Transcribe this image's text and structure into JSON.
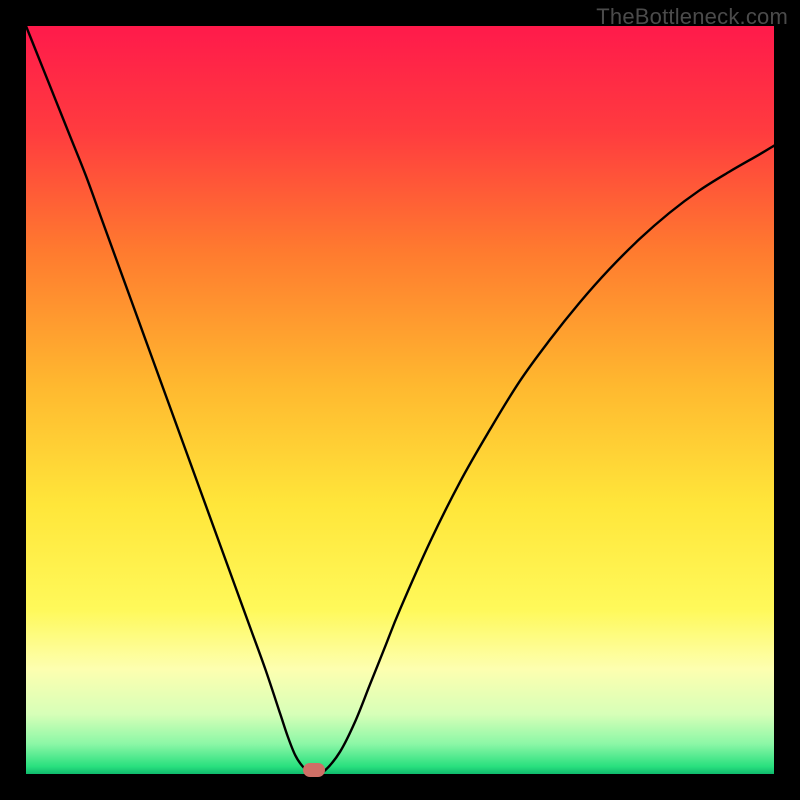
{
  "watermark": "TheBottleneck.com",
  "chart_data": {
    "type": "line",
    "title": "",
    "xlabel": "",
    "ylabel": "",
    "xlim": [
      0,
      100
    ],
    "ylim": [
      0,
      100
    ],
    "x": [
      0,
      2,
      4,
      6,
      8,
      10,
      12,
      14,
      16,
      18,
      20,
      22,
      24,
      26,
      28,
      30,
      32,
      34,
      35,
      36,
      37,
      38,
      39,
      40,
      42,
      44,
      46,
      48,
      50,
      54,
      58,
      62,
      66,
      70,
      74,
      78,
      82,
      86,
      90,
      94,
      98,
      100
    ],
    "values": [
      100,
      95,
      90,
      85,
      80,
      74.5,
      69,
      63.5,
      58,
      52.5,
      47,
      41.5,
      36,
      30.5,
      25,
      19.5,
      14,
      8,
      5,
      2.5,
      1,
      0.2,
      0.2,
      0.5,
      3,
      7,
      12,
      17,
      22,
      31,
      39,
      46,
      52.5,
      58,
      63,
      67.5,
      71.5,
      75,
      78,
      80.5,
      82.8,
      84
    ],
    "marker": {
      "x": 38.5,
      "y": 0.5,
      "color": "#cf6f66"
    },
    "gradient_stops": [
      {
        "pct": 0,
        "color": "#ff1a4b"
      },
      {
        "pct": 14,
        "color": "#ff3b3f"
      },
      {
        "pct": 30,
        "color": "#ff7a2f"
      },
      {
        "pct": 48,
        "color": "#ffb82f"
      },
      {
        "pct": 64,
        "color": "#ffe63a"
      },
      {
        "pct": 78,
        "color": "#fff95a"
      },
      {
        "pct": 86,
        "color": "#fdffb0"
      },
      {
        "pct": 92,
        "color": "#d7ffb8"
      },
      {
        "pct": 96,
        "color": "#8bf7a6"
      },
      {
        "pct": 99,
        "color": "#29e07e"
      },
      {
        "pct": 100,
        "color": "#0fba6d"
      }
    ],
    "curve_color": "#000000",
    "curve_width": 2.4
  }
}
